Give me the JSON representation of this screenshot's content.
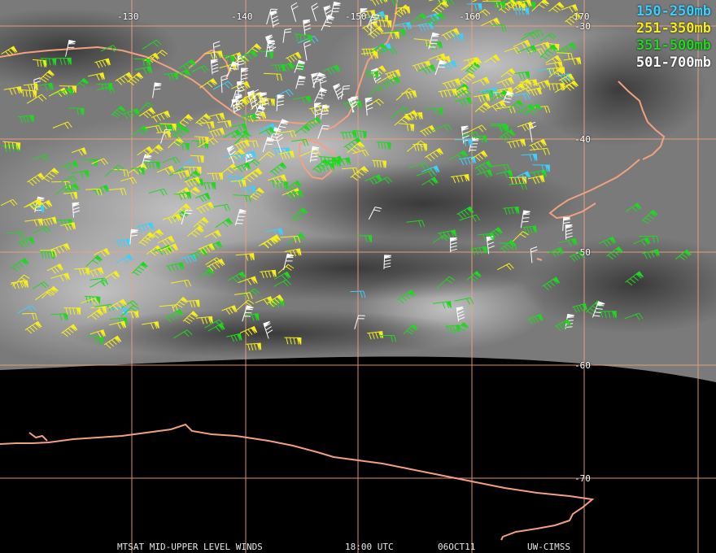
{
  "legend": [
    {
      "label": "150-250mb",
      "color": "#3ad0ff"
    },
    {
      "label": "251-350mb",
      "color": "#f7ee1a"
    },
    {
      "label": "351-500mb",
      "color": "#1ed91e"
    },
    {
      "label": "501-700mb",
      "color": "#ffffff"
    }
  ],
  "grid": {
    "longitude_labels": [
      "-130",
      "-140",
      "-150",
      "-160",
      "-170"
    ],
    "latitude_labels": [
      "-30",
      "-40",
      "-50",
      "-60",
      "-70"
    ],
    "line_color": "#f0a27c"
  },
  "footer": {
    "product": "MTSAT MID-UPPER LEVEL WINDS",
    "time": "18:00 UTC",
    "date": "06OCT11",
    "source": "UW-CIMSS"
  },
  "colors": {
    "coastline": "#f4a07e",
    "imagery_bright": "#d8d8d8",
    "imagery_dark": "#3a3a3a",
    "space_background": "#000000"
  }
}
